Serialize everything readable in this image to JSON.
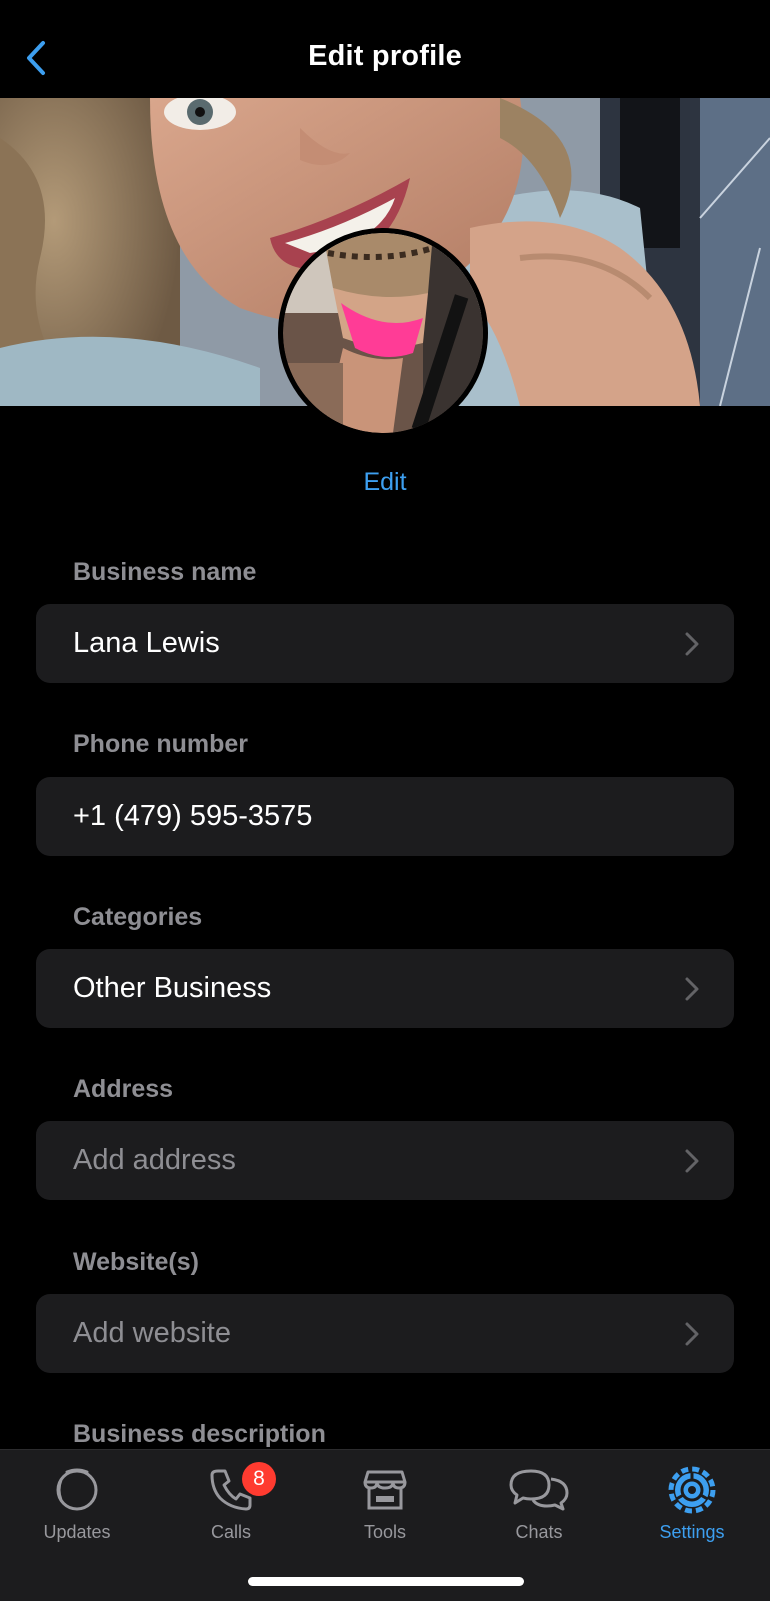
{
  "header": {
    "title": "Edit profile",
    "back_icon": "chevron-left-icon"
  },
  "profile": {
    "edit_label": "Edit"
  },
  "fields": [
    {
      "label": "Business name",
      "value": "Lana Lewis",
      "placeholder": false,
      "chevron": true
    },
    {
      "label": "Phone number",
      "value": "+1 (479) 595-3575",
      "placeholder": false,
      "chevron": false
    },
    {
      "label": "Categories",
      "value": "Other Business",
      "placeholder": false,
      "chevron": true
    },
    {
      "label": "Address",
      "value": "Add address",
      "placeholder": true,
      "chevron": true
    },
    {
      "label": "Website(s)",
      "value": "Add website",
      "placeholder": true,
      "chevron": true
    },
    {
      "label": "Business description"
    }
  ],
  "tabbar": {
    "tabs": [
      {
        "label": "Updates",
        "icon": "updates-icon"
      },
      {
        "label": "Calls",
        "icon": "phone-icon",
        "badge": "8"
      },
      {
        "label": "Tools",
        "icon": "storefront-icon"
      },
      {
        "label": "Chats",
        "icon": "chats-icon"
      },
      {
        "label": "Settings",
        "icon": "settings-gear-icon",
        "active": true
      }
    ]
  },
  "colors": {
    "accent": "#3d9ff0",
    "badge": "#ff3b30",
    "field_bg": "#1c1c1e",
    "label": "#8e8e93"
  }
}
